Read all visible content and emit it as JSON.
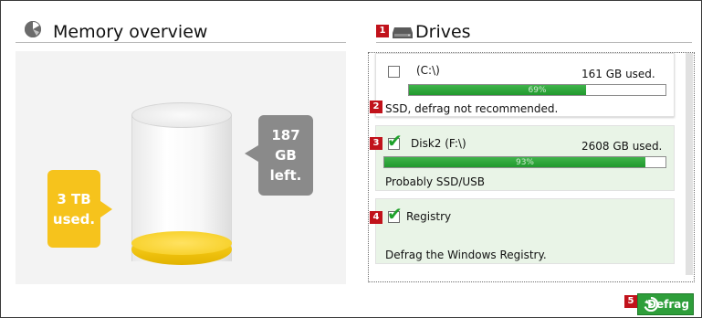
{
  "memory": {
    "title": "Memory overview",
    "used_label": "3 TB\nused.",
    "free_label": "187 GB\nleft."
  },
  "drives": {
    "title": "Drives",
    "items": [
      {
        "name": "(C:\\)",
        "used": "161 GB used.",
        "percent": "69%",
        "fill": 0.69,
        "checked": false,
        "note": "SSD, defrag not recommended.",
        "badge": "2"
      },
      {
        "name": "Disk2 (F:\\)",
        "used": "2608 GB used.",
        "percent": "93%",
        "fill": 0.93,
        "checked": true,
        "note": "Probably SSD/USB",
        "badge": "3"
      },
      {
        "name": "Registry",
        "checked": true,
        "note": "Defrag the Windows Registry.",
        "badge": "4"
      }
    ]
  },
  "badges": {
    "drives_header": "1",
    "defrag": "5"
  },
  "defrag_button": {
    "label": "Defrag"
  },
  "colors": {
    "accent_green": "#2e9e3a",
    "badge_red": "#c1121b",
    "used_gold": "#f6c31c",
    "free_gray": "#8a8a8a",
    "card_green_bg": "#e9f4e7"
  },
  "icons": {
    "memory": "pie-chart-icon",
    "drives": "hard-drive-icon",
    "defrag": "defrag-arrow-icon"
  }
}
